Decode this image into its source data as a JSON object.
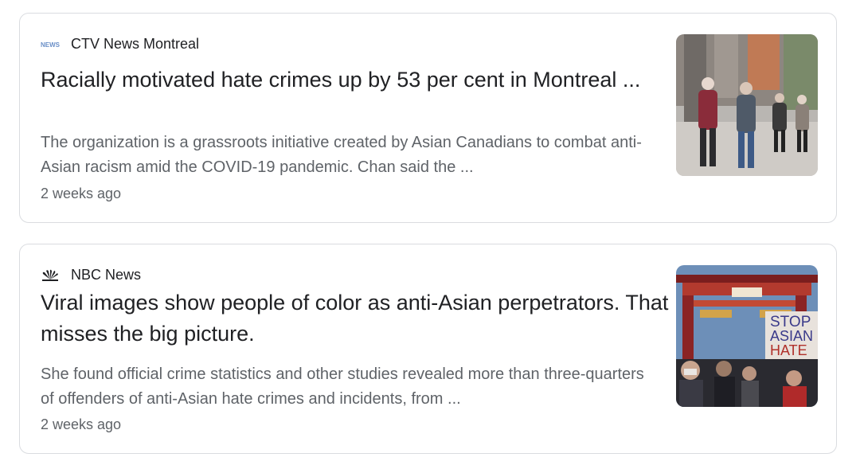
{
  "articles": [
    {
      "source": "CTV News Montreal",
      "source_icon": "ctv-news-logo-icon",
      "headline": "Racially motivated hate crimes up by 53 per cent in Montreal ...",
      "snippet": "The organization is a grassroots initiative created by Asian Canadians to combat anti-Asian racism amid the COVID-19 pandemic. Chan said the ...",
      "age": "2 weeks ago",
      "thumbnail": "people-walking-masks-street-photo"
    },
    {
      "source": "NBC News",
      "source_icon": "nbc-peacock-logo-icon",
      "headline": "Viral images show people of color as anti-Asian perpetrators. That misses the big picture.",
      "snippet": "She found official crime statistics and other studies revealed more than three-quarters of offenders of anti-Asian hate crimes and incidents, from ...",
      "age": "2 weeks ago",
      "thumbnail": "stop-asian-hate-protest-photo",
      "thumbnail_text": "STOP ASIAN HATE"
    }
  ]
}
